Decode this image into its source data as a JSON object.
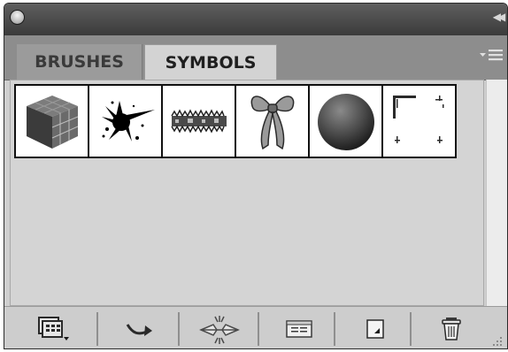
{
  "tabs": [
    {
      "label": "BRUSHES",
      "active": false
    },
    {
      "label": "SYMBOLS",
      "active": true
    }
  ],
  "icons": {
    "close": "close-icon",
    "collapse": "collapse-arrows-icon",
    "panel_menu": "panel-menu-icon"
  },
  "symbols": [
    {
      "name": "cube-symbol"
    },
    {
      "name": "splat-symbol"
    },
    {
      "name": "fuzzy-band-symbol"
    },
    {
      "name": "ribbon-bow-symbol"
    },
    {
      "name": "sphere-symbol"
    },
    {
      "name": "frame-corners-symbol"
    }
  ],
  "toolbar": [
    {
      "name": "symbol-libraries-menu-icon"
    },
    {
      "name": "place-symbol-instance-icon"
    },
    {
      "name": "break-link-icon"
    },
    {
      "name": "symbol-options-icon"
    },
    {
      "name": "new-symbol-icon"
    },
    {
      "name": "delete-symbol-icon"
    }
  ],
  "colors": {
    "panel_bg": "#cfcfcf",
    "titlebar": "#4a4a4a",
    "tabbar": "#8d8d8d",
    "active_tab": "#d3d3d3"
  }
}
